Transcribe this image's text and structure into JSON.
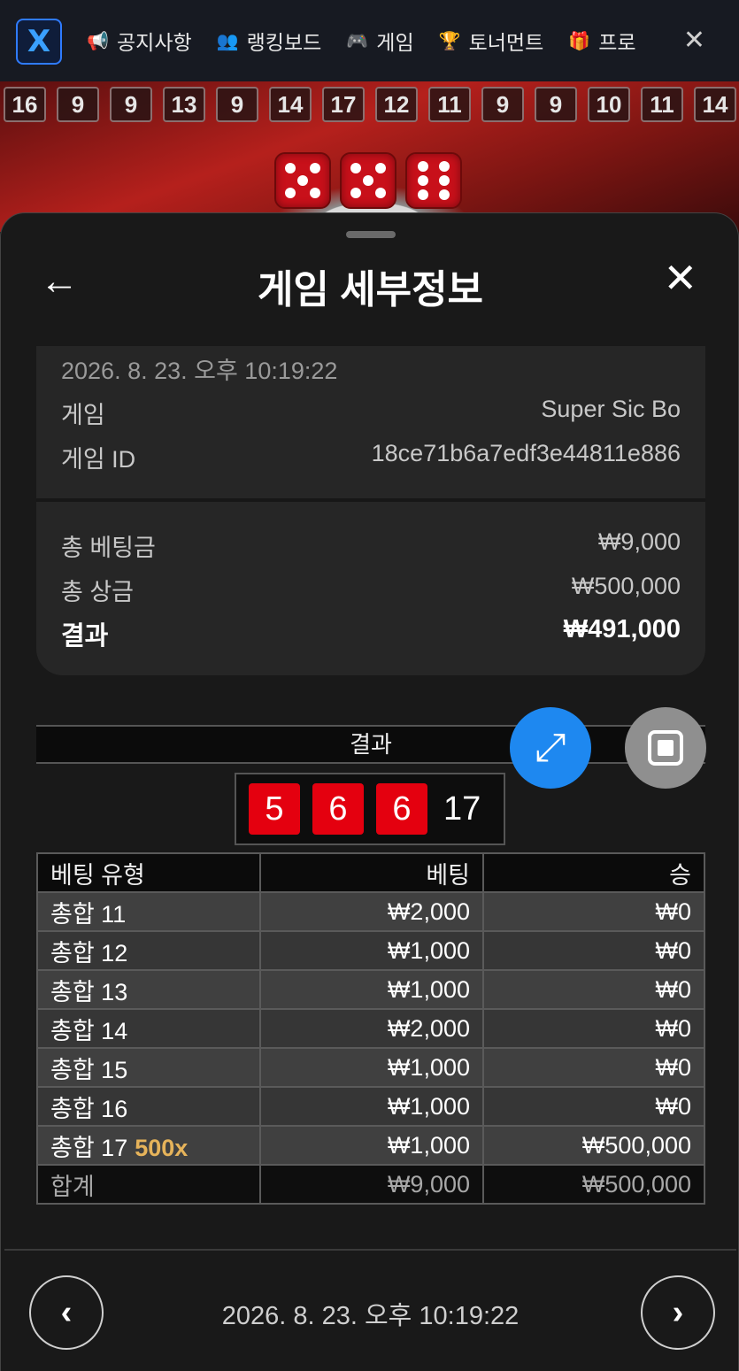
{
  "nav": {
    "items": [
      {
        "icon": "megaphone-icon",
        "glyph": "📢",
        "label": "공지사항"
      },
      {
        "icon": "users-icon",
        "glyph": "👥",
        "label": "랭킹보드"
      },
      {
        "icon": "gamepad-icon",
        "glyph": "🎮",
        "label": "게임"
      },
      {
        "icon": "trophy-icon",
        "glyph": "🏆",
        "label": "토너먼트"
      },
      {
        "icon": "gift-icon",
        "glyph": "🎁",
        "label": "프로"
      }
    ],
    "logo": "X"
  },
  "history": [
    "16",
    "9",
    "9",
    "13",
    "9",
    "14",
    "17",
    "12",
    "11",
    "9",
    "9",
    "10",
    "11",
    "14"
  ],
  "sheet": {
    "title": "게임 세부정보",
    "datetime": "2026. 8. 23. 오후 10:19:22",
    "game_label": "게임",
    "game_value": "Super Sic Bo",
    "game_id_label": "게임 ID",
    "game_id_value": "18ce71b6a7edf3e44811e886",
    "total_bet_label": "총 베팅금",
    "total_bet_value": "₩9,000",
    "total_prize_label": "총 상금",
    "total_prize_value": "₩500,000",
    "result_label": "결과",
    "result_value": "₩491,000"
  },
  "result": {
    "header": "결과",
    "dice": [
      "5",
      "6",
      "6"
    ],
    "sum": "17"
  },
  "table": {
    "headers": [
      "베팅 유형",
      "베팅",
      "승"
    ],
    "rows": [
      {
        "type": "총합 11",
        "mult": "",
        "bet": "₩2,000",
        "win": "₩0"
      },
      {
        "type": "총합 12",
        "mult": "",
        "bet": "₩1,000",
        "win": "₩0"
      },
      {
        "type": "총합 13",
        "mult": "",
        "bet": "₩1,000",
        "win": "₩0"
      },
      {
        "type": "총합 14",
        "mult": "",
        "bet": "₩2,000",
        "win": "₩0"
      },
      {
        "type": "총합 15",
        "mult": "",
        "bet": "₩1,000",
        "win": "₩0"
      },
      {
        "type": "총합 16",
        "mult": "",
        "bet": "₩1,000",
        "win": "₩0"
      },
      {
        "type": "총합 17",
        "mult": "500x",
        "bet": "₩1,000",
        "win": "₩500,000"
      }
    ],
    "total": {
      "label": "합계",
      "bet": "₩9,000",
      "win": "₩500,000"
    }
  },
  "footer": {
    "datetime": "2026. 8. 23. 오후 10:19:22"
  },
  "colors": {
    "accent_blue": "#1e88f0",
    "die_red": "#e4000f",
    "multiplier_gold": "#e6b35a"
  }
}
